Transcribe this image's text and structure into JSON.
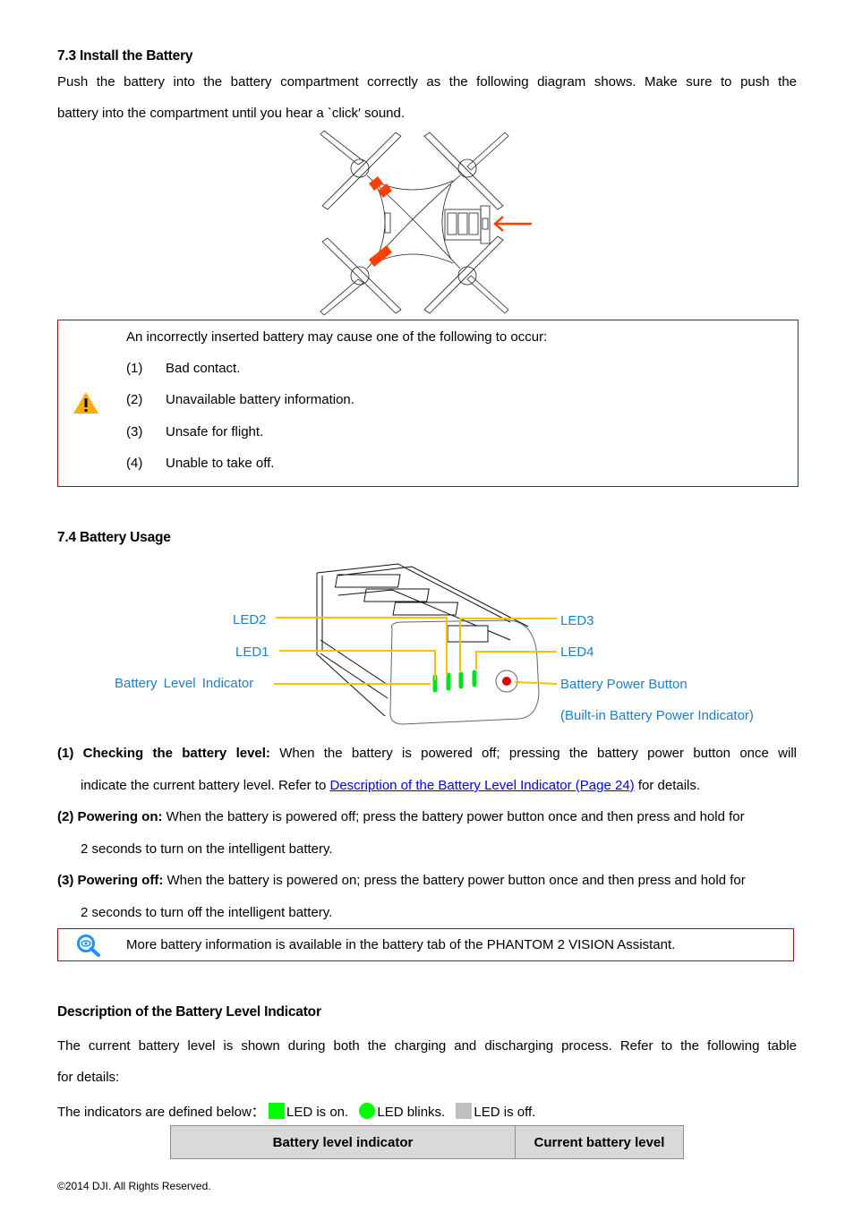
{
  "section_7_3": {
    "heading": "7.3 Install the Battery",
    "para_line1": "Push the battery into the battery compartment correctly as the following diagram shows. Make sure to push the",
    "para_line2": "battery into the compartment until you hear a `click′ sound."
  },
  "warning_box": {
    "icon": "warning-triangle-icon",
    "intro": "An incorrectly inserted battery may cause one of the following to occur:",
    "items": [
      {
        "num": "(1)",
        "text": "Bad contact."
      },
      {
        "num": "(2)",
        "text": "Unavailable battery information."
      },
      {
        "num": "(3)",
        "text": "Unsafe for flight."
      },
      {
        "num": "(4)",
        "text": "Unable to take off."
      }
    ]
  },
  "section_7_4": {
    "heading": "7.4 Battery Usage",
    "diagram_labels": {
      "led2": "LED2",
      "led1": "LED1",
      "battery_level_indicator": "Battery  Level  Indicator",
      "led3": "LED3",
      "led4": "LED4",
      "power_button": "Battery Power Button",
      "power_indicator": "(Built-in Battery Power Indicator)"
    },
    "steps": [
      {
        "label": "(1) Checking the battery level:",
        "text1": " When the battery is powered off; pressing the battery power button once will",
        "text2_pre": "indicate the current battery level. Refer to ",
        "link": "Description of the Battery Level Indicator (Page 24)",
        "text2_post": " for details."
      },
      {
        "label": "(2) Powering on:",
        "text1": " When the battery is powered off; press the battery power button once and then press and hold for",
        "text2": "2 seconds to turn on the intelligent battery."
      },
      {
        "label": "(3) Powering off:",
        "text1": " When the battery is powered on; press the battery power button once and then press and hold for",
        "text2": "2 seconds to turn off the intelligent battery."
      }
    ]
  },
  "tip_box": {
    "icon": "magnifier-eye-icon",
    "text": "More battery information is available in the battery tab of the PHANTOM 2 VISION Assistant."
  },
  "description": {
    "heading": "Description of the Battery Level Indicator",
    "para_line1": "The current battery level is shown during both the charging and discharging process. Refer to the following table",
    "para_line2": "for details:",
    "legend_prefix": "The indicators are defined below：",
    "legend": [
      {
        "shape": "square",
        "color": "#00ff00",
        "label": "LED is on."
      },
      {
        "shape": "circle",
        "color": "#00ff00",
        "label": "LED blinks."
      },
      {
        "shape": "square",
        "color": "#bfbfbf",
        "label": "LED is off."
      }
    ],
    "table_headers": [
      "Battery level indicator",
      "Current battery level"
    ]
  },
  "colors": {
    "box_border": "#c00000",
    "label_blue": "#1f7fc4",
    "leader_line": "#ffc000",
    "led_green": "#00e020",
    "accent_orange": "#ff4000",
    "table_header_bg": "#d9d9d9"
  },
  "footer": {
    "copyright": "©2014 DJI. All Rights Reserved."
  }
}
